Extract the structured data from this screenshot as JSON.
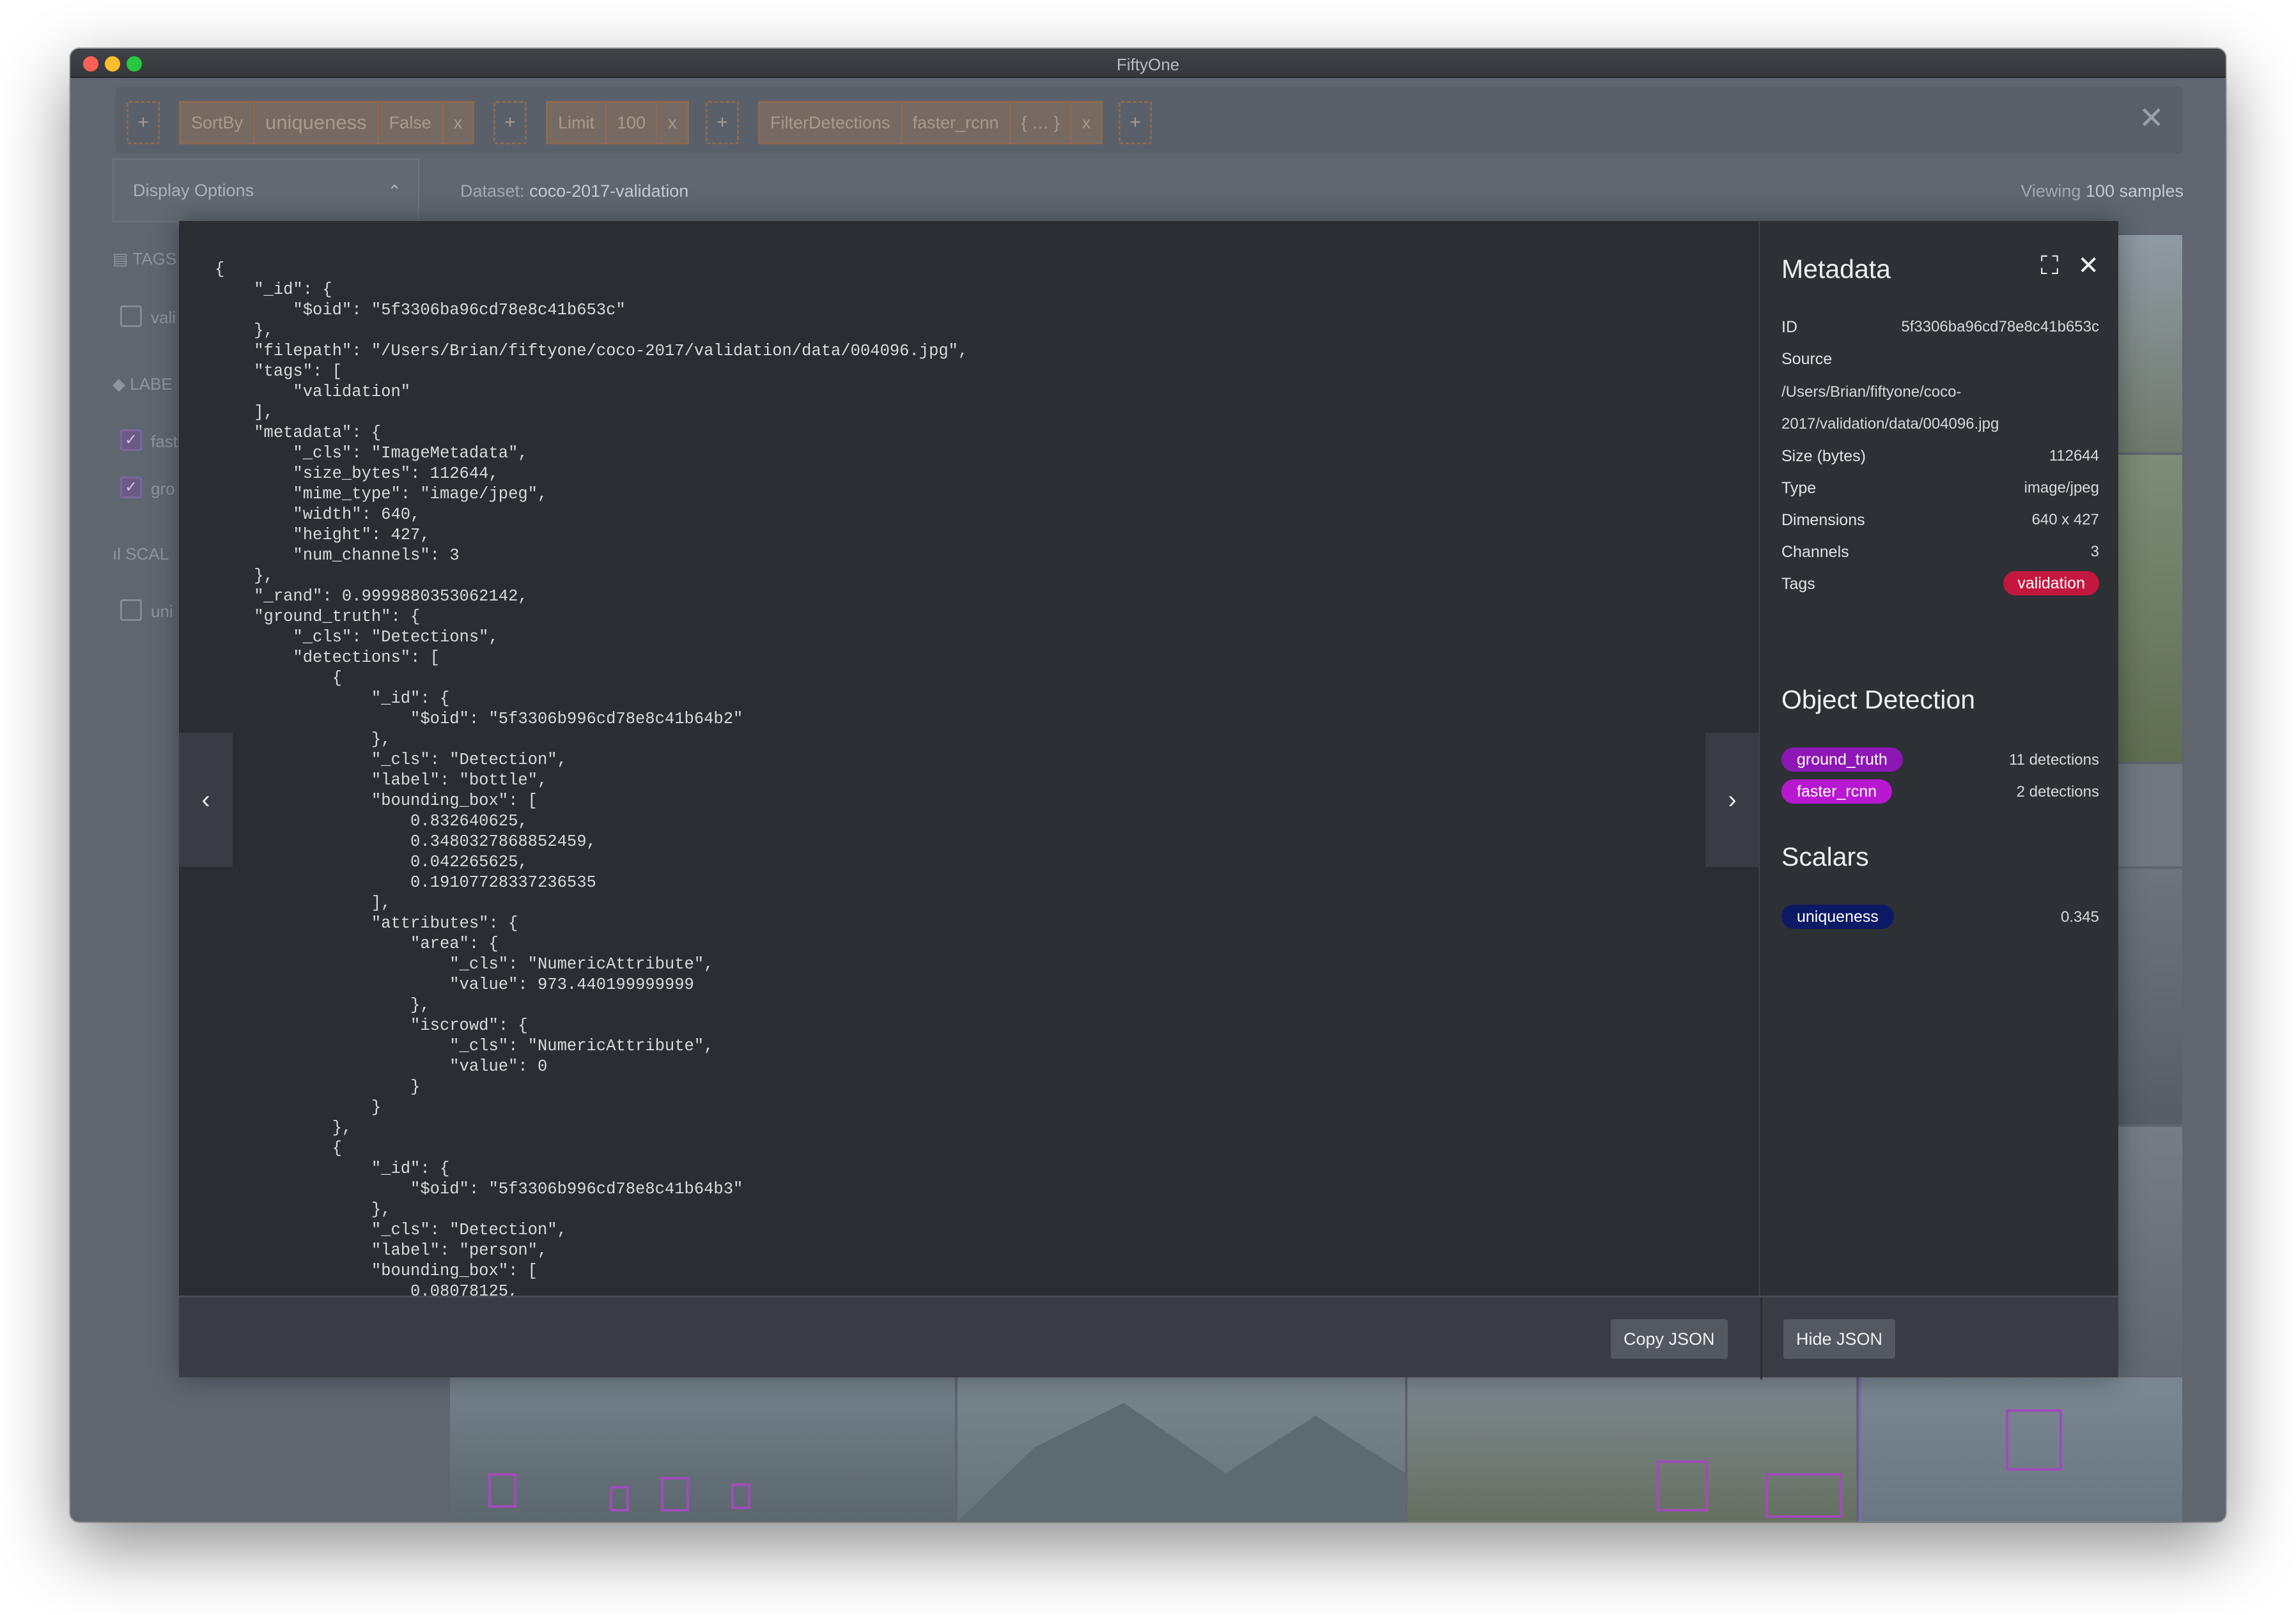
{
  "window": {
    "title": "FiftyOne"
  },
  "toolbar": {
    "add_label": "+",
    "close_label": "✕",
    "stages": [
      {
        "name": "SortBy",
        "params": [
          "uniqueness",
          "False"
        ],
        "remove": "x"
      },
      {
        "name": "Limit",
        "params": [
          "100"
        ],
        "remove": "x"
      },
      {
        "name": "FilterDetections",
        "params": [
          "faster_rcnn",
          "{ … }"
        ],
        "remove": "x"
      }
    ]
  },
  "display_options": {
    "label": "Display Options",
    "chevron": "⌃"
  },
  "dataset": {
    "prefix": "Dataset:",
    "name": "coco-2017-validation"
  },
  "viewing": {
    "prefix": "Viewing",
    "count": "100 samples"
  },
  "sidebar": {
    "tags_header": "TAGS",
    "tag_item": "vali",
    "labels_header": "LABE",
    "label_items": [
      "fast",
      "gro"
    ],
    "scalars_header": "SCAL",
    "scalar_item": "uni"
  },
  "modal": {
    "nav_prev": "‹",
    "nav_next": "›",
    "json_text": "{\n    \"_id\": {\n        \"$oid\": \"5f3306ba96cd78e8c41b653c\"\n    },\n    \"filepath\": \"/Users/Brian/fiftyone/coco-2017/validation/data/004096.jpg\",\n    \"tags\": [\n        \"validation\"\n    ],\n    \"metadata\": {\n        \"_cls\": \"ImageMetadata\",\n        \"size_bytes\": 112644,\n        \"mime_type\": \"image/jpeg\",\n        \"width\": 640,\n        \"height\": 427,\n        \"num_channels\": 3\n    },\n    \"_rand\": 0.9999880353062142,\n    \"ground_truth\": {\n        \"_cls\": \"Detections\",\n        \"detections\": [\n            {\n                \"_id\": {\n                    \"$oid\": \"5f3306b996cd78e8c41b64b2\"\n                },\n                \"_cls\": \"Detection\",\n                \"label\": \"bottle\",\n                \"bounding_box\": [\n                    0.832640625,\n                    0.3480327868852459,\n                    0.042265625,\n                    0.19107728337236535\n                ],\n                \"attributes\": {\n                    \"area\": {\n                        \"_cls\": \"NumericAttribute\",\n                        \"value\": 973.440199999999\n                    },\n                    \"iscrowd\": {\n                        \"_cls\": \"NumericAttribute\",\n                        \"value\": 0\n                    }\n                }\n            },\n            {\n                \"_id\": {\n                    \"$oid\": \"5f3306b996cd78e8c41b64b3\"\n                },\n                \"_cls\": \"Detection\",\n                \"label\": \"person\",\n                \"bounding_box\": [\n                    0.08078125,",
    "metadata": {
      "title": "Metadata",
      "expand_icon": "⛶",
      "close_icon": "✕",
      "id_key": "ID",
      "id_val": "5f3306ba96cd78e8c41b653c",
      "source_key": "Source",
      "source_line1": "/Users/Brian/fiftyone/coco-",
      "source_line2": "2017/validation/data/004096.jpg",
      "size_key": "Size (bytes)",
      "size_val": "112644",
      "type_key": "Type",
      "type_val": "image/jpeg",
      "dims_key": "Dimensions",
      "dims_val": "640 x 427",
      "channels_key": "Channels",
      "channels_val": "3",
      "tags_key": "Tags",
      "tags_val": "validation"
    },
    "object_detection": {
      "title": "Object Detection",
      "fields": [
        {
          "name": "ground_truth",
          "count": "11 detections",
          "color": "#8d17b5"
        },
        {
          "name": "faster_rcnn",
          "count": "2 detections",
          "color": "#b718d0"
        }
      ]
    },
    "scalars": {
      "title": "Scalars",
      "fields": [
        {
          "name": "uniqueness",
          "value": "0.345",
          "color": "#0c1a66"
        }
      ]
    },
    "footer": {
      "copy_json": "Copy JSON",
      "hide_json": "Hide JSON"
    }
  },
  "colors": {
    "stage_border": "#8c6a52",
    "tag_pill": "#c4173f",
    "modal_bg": "#2b2e33"
  }
}
